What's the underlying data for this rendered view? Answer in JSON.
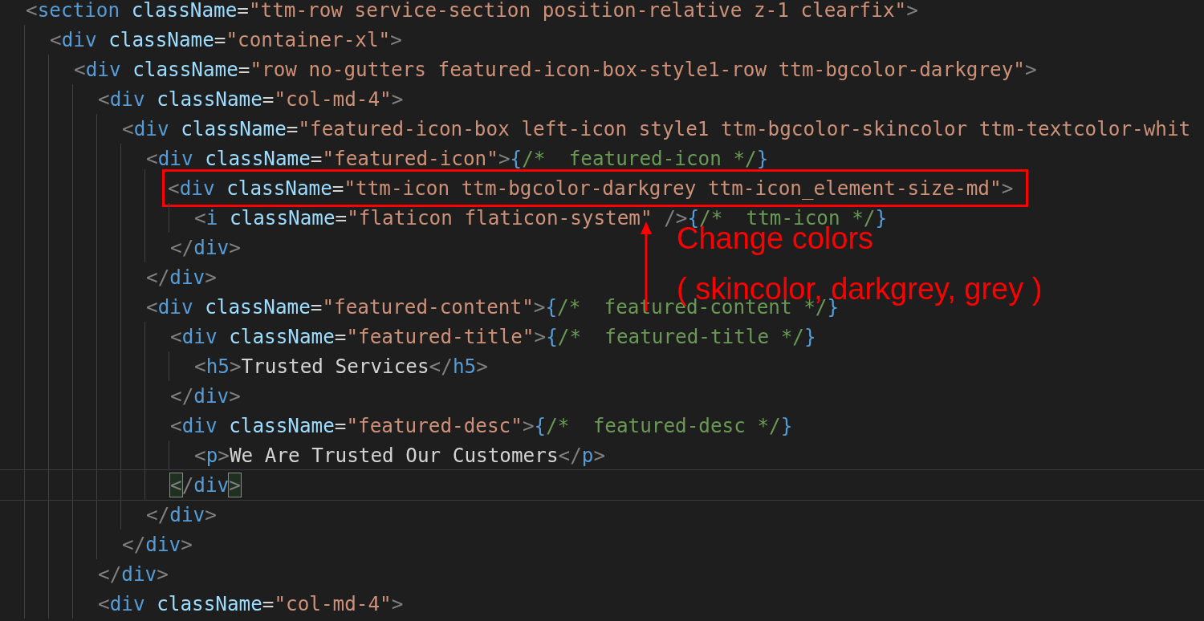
{
  "code": [
    {
      "current": false,
      "highlighted": false,
      "tokens": [
        {
          "kind": "bracket",
          "text": "<"
        },
        {
          "kind": "tag",
          "text": "section"
        },
        {
          "kind": "attr",
          "text": " className"
        },
        {
          "kind": "op",
          "text": "="
        },
        {
          "kind": "string",
          "text": "\"ttm-row service-section position-relative z-1 clearfix\""
        },
        {
          "kind": "bracket",
          "text": ">"
        }
      ],
      "children": [
        {
          "current": false,
          "highlighted": false,
          "tokens": [
            {
              "kind": "bracket",
              "text": "<"
            },
            {
              "kind": "tag",
              "text": "div"
            },
            {
              "kind": "attr",
              "text": " className"
            },
            {
              "kind": "op",
              "text": "="
            },
            {
              "kind": "string",
              "text": "\"container-xl\""
            },
            {
              "kind": "bracket",
              "text": ">"
            }
          ],
          "children": [
            {
              "current": false,
              "highlighted": false,
              "tokens": [
                {
                  "kind": "bracket",
                  "text": "<"
                },
                {
                  "kind": "tag",
                  "text": "div"
                },
                {
                  "kind": "attr",
                  "text": " className"
                },
                {
                  "kind": "op",
                  "text": "="
                },
                {
                  "kind": "string",
                  "text": "\"row no-gutters featured-icon-box-style1-row ttm-bgcolor-darkgrey\""
                },
                {
                  "kind": "bracket",
                  "text": ">"
                }
              ],
              "children": [
                {
                  "current": false,
                  "highlighted": false,
                  "tokens": [
                    {
                      "kind": "bracket",
                      "text": "<"
                    },
                    {
                      "kind": "tag",
                      "text": "div"
                    },
                    {
                      "kind": "attr",
                      "text": " className"
                    },
                    {
                      "kind": "op",
                      "text": "="
                    },
                    {
                      "kind": "string",
                      "text": "\"col-md-4\""
                    },
                    {
                      "kind": "bracket",
                      "text": ">"
                    }
                  ],
                  "children": [
                    {
                      "current": false,
                      "highlighted": false,
                      "tokens": [
                        {
                          "kind": "bracket",
                          "text": "<"
                        },
                        {
                          "kind": "tag",
                          "text": "div"
                        },
                        {
                          "kind": "attr",
                          "text": " className"
                        },
                        {
                          "kind": "op",
                          "text": "="
                        },
                        {
                          "kind": "string",
                          "text": "\"featured-icon-box left-icon style1 ttm-bgcolor-skincolor ttm-textcolor-whit"
                        }
                      ],
                      "children": [
                        {
                          "current": false,
                          "highlighted": false,
                          "tokens": [
                            {
                              "kind": "bracket",
                              "text": "<"
                            },
                            {
                              "kind": "tag",
                              "text": "div"
                            },
                            {
                              "kind": "attr",
                              "text": " className"
                            },
                            {
                              "kind": "op",
                              "text": "="
                            },
                            {
                              "kind": "string",
                              "text": "\"featured-icon\""
                            },
                            {
                              "kind": "bracket",
                              "text": ">"
                            },
                            {
                              "kind": "brace",
                              "text": "{"
                            },
                            {
                              "kind": "comment",
                              "text": "/*  featured-icon */"
                            },
                            {
                              "kind": "brace",
                              "text": "}"
                            }
                          ],
                          "children": [
                            {
                              "current": false,
                              "highlighted": true,
                              "tokens": [
                                {
                                  "kind": "bracket",
                                  "text": "<"
                                },
                                {
                                  "kind": "tag",
                                  "text": "div"
                                },
                                {
                                  "kind": "attr",
                                  "text": " className"
                                },
                                {
                                  "kind": "op",
                                  "text": "="
                                },
                                {
                                  "kind": "string",
                                  "text": "\"ttm-icon ttm-bgcolor-darkgrey ttm-icon_element-size-md\""
                                },
                                {
                                  "kind": "bracket",
                                  "text": ">"
                                }
                              ],
                              "children": [
                                {
                                  "current": false,
                                  "highlighted": false,
                                  "tokens": [
                                    {
                                      "kind": "bracket",
                                      "text": "<"
                                    },
                                    {
                                      "kind": "tag",
                                      "text": "i"
                                    },
                                    {
                                      "kind": "attr",
                                      "text": " className"
                                    },
                                    {
                                      "kind": "op",
                                      "text": "="
                                    },
                                    {
                                      "kind": "string",
                                      "text": "\"flaticon flaticon-system\""
                                    },
                                    {
                                      "kind": "bracket",
                                      "text": " />"
                                    },
                                    {
                                      "kind": "brace",
                                      "text": "{"
                                    },
                                    {
                                      "kind": "comment",
                                      "text": "/*  ttm-icon */"
                                    },
                                    {
                                      "kind": "brace",
                                      "text": "}"
                                    }
                                  ]
                                }
                              ]
                            },
                            {
                              "current": false,
                              "highlighted": false,
                              "tokens": [
                                {
                                  "kind": "bracket",
                                  "text": "</"
                                },
                                {
                                  "kind": "tag",
                                  "text": "div"
                                },
                                {
                                  "kind": "bracket",
                                  "text": ">"
                                }
                              ]
                            }
                          ]
                        },
                        {
                          "current": false,
                          "highlighted": false,
                          "tokens": [
                            {
                              "kind": "bracket",
                              "text": "</"
                            },
                            {
                              "kind": "tag",
                              "text": "div"
                            },
                            {
                              "kind": "bracket",
                              "text": ">"
                            }
                          ]
                        },
                        {
                          "current": false,
                          "highlighted": false,
                          "tokens": [
                            {
                              "kind": "bracket",
                              "text": "<"
                            },
                            {
                              "kind": "tag",
                              "text": "div"
                            },
                            {
                              "kind": "attr",
                              "text": " className"
                            },
                            {
                              "kind": "op",
                              "text": "="
                            },
                            {
                              "kind": "string",
                              "text": "\"featured-content\""
                            },
                            {
                              "kind": "bracket",
                              "text": ">"
                            },
                            {
                              "kind": "brace",
                              "text": "{"
                            },
                            {
                              "kind": "comment",
                              "text": "/*  featured-content */"
                            },
                            {
                              "kind": "brace",
                              "text": "}"
                            }
                          ],
                          "children": [
                            {
                              "current": false,
                              "highlighted": false,
                              "tokens": [
                                {
                                  "kind": "bracket",
                                  "text": "<"
                                },
                                {
                                  "kind": "tag",
                                  "text": "div"
                                },
                                {
                                  "kind": "attr",
                                  "text": " className"
                                },
                                {
                                  "kind": "op",
                                  "text": "="
                                },
                                {
                                  "kind": "string",
                                  "text": "\"featured-title\""
                                },
                                {
                                  "kind": "bracket",
                                  "text": ">"
                                },
                                {
                                  "kind": "brace",
                                  "text": "{"
                                },
                                {
                                  "kind": "comment",
                                  "text": "/*  featured-title */"
                                },
                                {
                                  "kind": "brace",
                                  "text": "}"
                                }
                              ],
                              "children": [
                                {
                                  "current": false,
                                  "highlighted": false,
                                  "tokens": [
                                    {
                                      "kind": "bracket",
                                      "text": "<"
                                    },
                                    {
                                      "kind": "tag",
                                      "text": "h5"
                                    },
                                    {
                                      "kind": "bracket",
                                      "text": ">"
                                    },
                                    {
                                      "kind": "text",
                                      "text": "Trusted Services"
                                    },
                                    {
                                      "kind": "bracket",
                                      "text": "</"
                                    },
                                    {
                                      "kind": "tag",
                                      "text": "h5"
                                    },
                                    {
                                      "kind": "bracket",
                                      "text": ">"
                                    }
                                  ]
                                }
                              ]
                            },
                            {
                              "current": false,
                              "highlighted": false,
                              "tokens": [
                                {
                                  "kind": "bracket",
                                  "text": "</"
                                },
                                {
                                  "kind": "tag",
                                  "text": "div"
                                },
                                {
                                  "kind": "bracket",
                                  "text": ">"
                                }
                              ]
                            },
                            {
                              "current": false,
                              "highlighted": false,
                              "tokens": [
                                {
                                  "kind": "bracket",
                                  "text": "<"
                                },
                                {
                                  "kind": "tag",
                                  "text": "div"
                                },
                                {
                                  "kind": "attr",
                                  "text": " className"
                                },
                                {
                                  "kind": "op",
                                  "text": "="
                                },
                                {
                                  "kind": "string",
                                  "text": "\"featured-desc\""
                                },
                                {
                                  "kind": "bracket",
                                  "text": ">"
                                },
                                {
                                  "kind": "brace",
                                  "text": "{"
                                },
                                {
                                  "kind": "comment",
                                  "text": "/*  featured-desc */"
                                },
                                {
                                  "kind": "brace",
                                  "text": "}"
                                }
                              ],
                              "children": [
                                {
                                  "current": false,
                                  "highlighted": false,
                                  "tokens": [
                                    {
                                      "kind": "bracket",
                                      "text": "<"
                                    },
                                    {
                                      "kind": "tag",
                                      "text": "p"
                                    },
                                    {
                                      "kind": "bracket",
                                      "text": ">"
                                    },
                                    {
                                      "kind": "text",
                                      "text": "We Are Trusted Our Customers"
                                    },
                                    {
                                      "kind": "bracket",
                                      "text": "</"
                                    },
                                    {
                                      "kind": "tag",
                                      "text": "p"
                                    },
                                    {
                                      "kind": "bracket",
                                      "text": ">"
                                    }
                                  ]
                                }
                              ]
                            },
                            {
                              "current": true,
                              "highlighted": false,
                              "tokens": [
                                {
                                  "kind": "matched",
                                  "text": "<"
                                },
                                {
                                  "kind": "bracket",
                                  "text": "/"
                                },
                                {
                                  "kind": "tag",
                                  "text": "div"
                                },
                                {
                                  "kind": "matched",
                                  "text": ">"
                                }
                              ]
                            }
                          ]
                        },
                        {
                          "current": false,
                          "highlighted": false,
                          "tokens": [
                            {
                              "kind": "bracket",
                              "text": "</"
                            },
                            {
                              "kind": "tag",
                              "text": "div"
                            },
                            {
                              "kind": "bracket",
                              "text": ">"
                            }
                          ]
                        }
                      ]
                    },
                    {
                      "current": false,
                      "highlighted": false,
                      "tokens": [
                        {
                          "kind": "bracket",
                          "text": "</"
                        },
                        {
                          "kind": "tag",
                          "text": "div"
                        },
                        {
                          "kind": "bracket",
                          "text": ">"
                        }
                      ]
                    }
                  ]
                },
                {
                  "current": false,
                  "highlighted": false,
                  "tokens": [
                    {
                      "kind": "bracket",
                      "text": "</"
                    },
                    {
                      "kind": "tag",
                      "text": "div"
                    },
                    {
                      "kind": "bracket",
                      "text": ">"
                    }
                  ]
                },
                {
                  "current": false,
                  "highlighted": false,
                  "tokens": [
                    {
                      "kind": "bracket",
                      "text": "<"
                    },
                    {
                      "kind": "tag",
                      "text": "div"
                    },
                    {
                      "kind": "attr",
                      "text": " className"
                    },
                    {
                      "kind": "op",
                      "text": "="
                    },
                    {
                      "kind": "string",
                      "text": "\"col-md-4\""
                    },
                    {
                      "kind": "bracket",
                      "text": ">"
                    }
                  ]
                }
              ]
            }
          ]
        }
      ]
    }
  ],
  "annotation": {
    "lines": [
      "Change colors",
      "( skincolor, darkgrey, grey )"
    ]
  }
}
